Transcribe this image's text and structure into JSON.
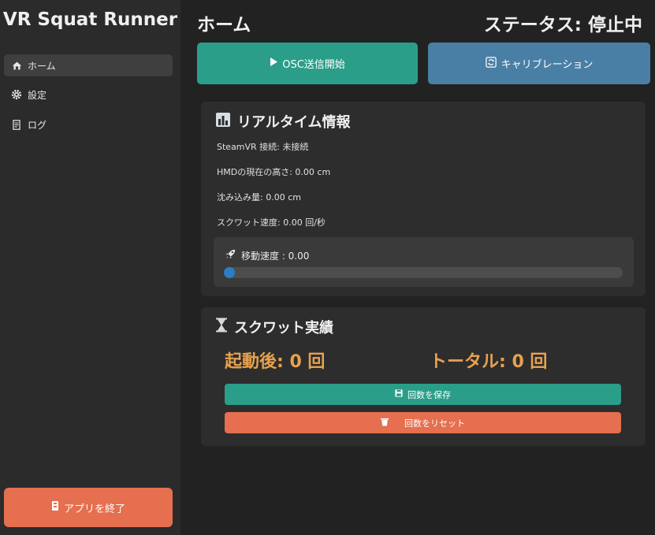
{
  "app": {
    "title": "VR Squat Runner"
  },
  "sidebar": {
    "items": [
      {
        "label": "ホーム",
        "icon": "home-icon"
      },
      {
        "label": "設定",
        "icon": "gear-icon"
      },
      {
        "label": "ログ",
        "icon": "log-icon"
      }
    ],
    "exit_label": "アプリを終了"
  },
  "header": {
    "title": "ホーム",
    "status": "ステータス: 停止中"
  },
  "toolbar": {
    "osc_label": "OSC送信開始",
    "calibrate_label": "キャリブレーション"
  },
  "realtime": {
    "title": "リアルタイム情報",
    "steamvr": "SteamVR 接続: 未接続",
    "hmd_height": "HMDの現在の高さ: 0.00 cm",
    "sink": "沈み込み量: 0.00 cm",
    "squat_speed": "スクワット速度: 0.00 回/秒",
    "move_speed_label": "移動速度 : 0.00",
    "move_speed_fraction": 0.0
  },
  "squat": {
    "title": "スクワット実績",
    "since_launch": "起動後: 0 回",
    "total": "トータル: 0 回",
    "save_label": "回数を保存",
    "reset_label": "回数をリセット"
  },
  "colors": {
    "teal": "#2a9e89",
    "blue": "#4a7fa5",
    "orange": "#e56f4f",
    "count_gold": "#e8a14f",
    "progress_blue": "#2a7ec5"
  }
}
